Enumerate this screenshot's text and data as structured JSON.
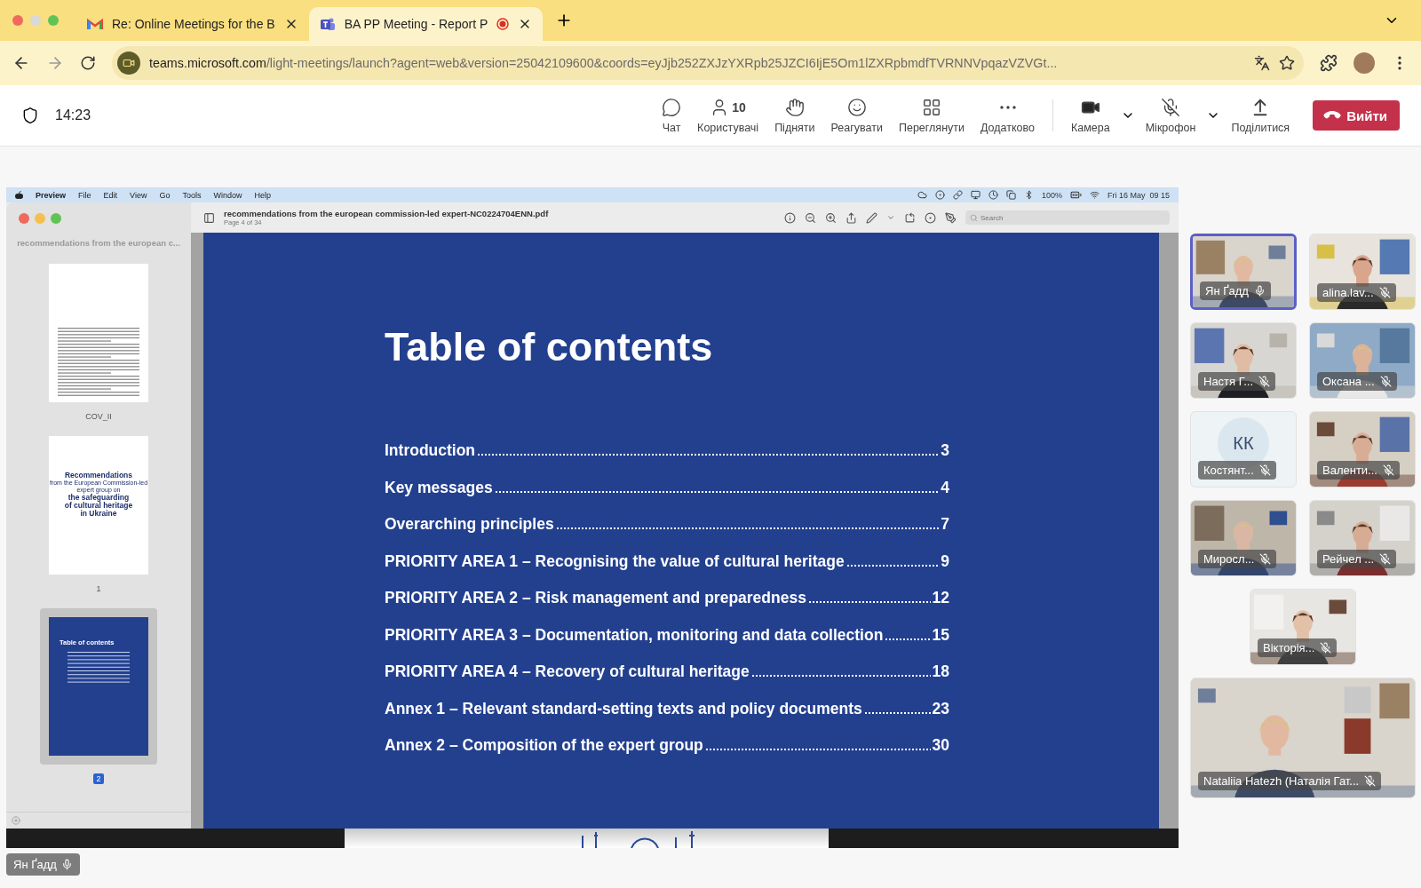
{
  "browser": {
    "tabs": [
      {
        "kind": "mail",
        "title": "Re: Online Meetings for the B",
        "selected": false,
        "recording": false
      },
      {
        "kind": "teams",
        "title": "BA PP Meeting - Report P",
        "selected": true,
        "recording": true
      }
    ],
    "url_host": "teams.microsoft.com",
    "url_path": "/light-meetings/launch?agent=web&version=25042109600&coords=eyJjb252ZXJzYXRpb25JZCI6IjE5Om1lZXRpbmdfTVRNNVpqazVZVGt..."
  },
  "teams_bar": {
    "time": "14:23",
    "actions": [
      {
        "kind": "chat",
        "label": "Чат"
      },
      {
        "kind": "people",
        "label": "Користувачі",
        "count": "10"
      },
      {
        "kind": "raise",
        "label": "Підняти"
      },
      {
        "kind": "react",
        "label": "Реагувати"
      },
      {
        "kind": "view",
        "label": "Переглянути"
      },
      {
        "kind": "more",
        "label": "Додатково"
      }
    ],
    "devices": [
      {
        "kind": "camera",
        "label": "Камера",
        "on": true
      },
      {
        "kind": "mic",
        "label": "Мікрофон",
        "on": false
      }
    ],
    "share": {
      "label": "Поділитися"
    },
    "leave": {
      "label": "Вийти"
    }
  },
  "shared_screen": {
    "menubar": {
      "app": "Preview",
      "items": [
        "File",
        "Edit",
        "View",
        "Go",
        "Tools",
        "Window",
        "Help"
      ],
      "battery": "100%",
      "datetime": "Fri 16 May  09 15"
    },
    "preview": {
      "title": "recommendations from the european commission-led expert-NC0224704ENN.pdf",
      "subtitle": "Page 4 of 34",
      "search_placeholder": "Search",
      "sidebar_title": "recommendations from the european c...",
      "thumbnails": [
        {
          "kind": "text_page",
          "label": "COV_II",
          "selected": false
        },
        {
          "kind": "title_page",
          "label": "1",
          "selected": false,
          "lines": [
            "Recommendations",
            "from the European Commission-led",
            "expert group on",
            "the safeguarding",
            "of cultural heritage",
            "in Ukraine"
          ]
        },
        {
          "kind": "toc_page",
          "label": "2",
          "selected": true,
          "heading": "Table of contents"
        }
      ],
      "page": {
        "heading": "Table of contents",
        "entries": [
          {
            "text": "Introduction",
            "page": "3"
          },
          {
            "text": "Key messages",
            "page": "4"
          },
          {
            "text": "Overarching principles",
            "page": "7"
          },
          {
            "text": "PRIORITY AREA 1 – Recognising the value of cultural heritage",
            "page": "9"
          },
          {
            "text": "PRIORITY AREA 2 – Risk management and preparedness",
            "page": "12"
          },
          {
            "text": "PRIORITY AREA 3 – Documentation, monitoring and data collection",
            "page": "15"
          },
          {
            "text": "PRIORITY AREA 4 – Recovery of cultural heritage",
            "page": "18"
          },
          {
            "text": "Annex 1 – Relevant standard-setting texts and policy documents",
            "page": "23"
          },
          {
            "text": "Annex 2 – Composition of the expert group",
            "page": "30"
          }
        ]
      }
    },
    "presenter": {
      "name": "Ян Ґадд",
      "muted": false
    }
  },
  "participants": [
    {
      "name": "Ян Ґадд",
      "kind": "video",
      "muted": false,
      "selected": true,
      "wide": false
    },
    {
      "name": "alina.lav...",
      "kind": "video",
      "muted": true,
      "selected": false,
      "wide": false
    },
    {
      "name": "Настя Г...",
      "kind": "video",
      "muted": true,
      "selected": false,
      "wide": false
    },
    {
      "name": "Оксана ...",
      "kind": "video",
      "muted": true,
      "selected": false,
      "wide": false
    },
    {
      "name": "Костянт...",
      "kind": "initials",
      "initials": "КК",
      "muted": true,
      "selected": false,
      "wide": false
    },
    {
      "name": "Валенти...",
      "kind": "video",
      "muted": true,
      "selected": false,
      "wide": false
    },
    {
      "name": "Миросл...",
      "kind": "video",
      "muted": true,
      "selected": false,
      "wide": false
    },
    {
      "name": "Рейчел ...",
      "kind": "video",
      "muted": true,
      "selected": false,
      "wide": false
    },
    {
      "name": "Вікторія...",
      "kind": "video",
      "muted": true,
      "selected": false,
      "wide": false
    },
    {
      "name": "Nataliia Hatezh (Наталія Гат...",
      "kind": "video",
      "muted": true,
      "selected": false,
      "wide": true
    }
  ]
}
